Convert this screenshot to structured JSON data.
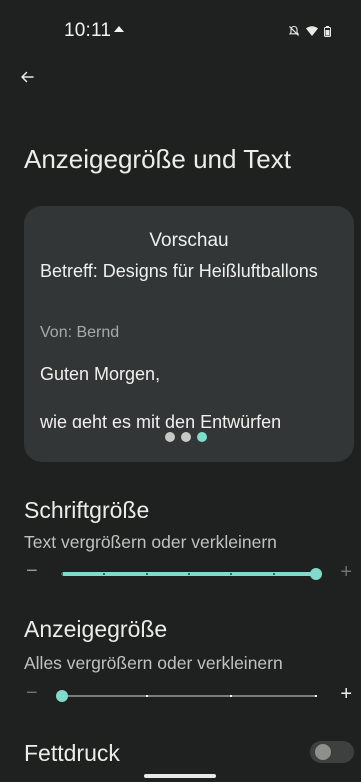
{
  "status_bar": {
    "time": "10:11"
  },
  "header": {
    "back_label": "←"
  },
  "page_title": "Anzeigegröße und Text",
  "preview": {
    "heading": "Vorschau",
    "subject": "Betreff: Designs für Heißluftballons",
    "from": "Von: Bernd",
    "greeting": "Guten Morgen,",
    "body": "wie geht es mit den Entwürfen",
    "page_count": 3,
    "active_page": 3
  },
  "font_size": {
    "title": "Schriftgröße",
    "subtitle": "Text vergrößern oder verkleinern",
    "minus_label": "−",
    "plus_label": "+",
    "value_fraction": 1.0
  },
  "display_size": {
    "title": "Anzeigegröße",
    "subtitle": "Alles vergrößern oder verkleinern",
    "minus_label": "−",
    "plus_label": "+",
    "value_fraction": 0.0
  },
  "bold_text": {
    "title": "Fettdruck",
    "enabled": false
  },
  "colors": {
    "accent": "#80dbcd",
    "background": "#1f2121",
    "card": "#333636"
  }
}
